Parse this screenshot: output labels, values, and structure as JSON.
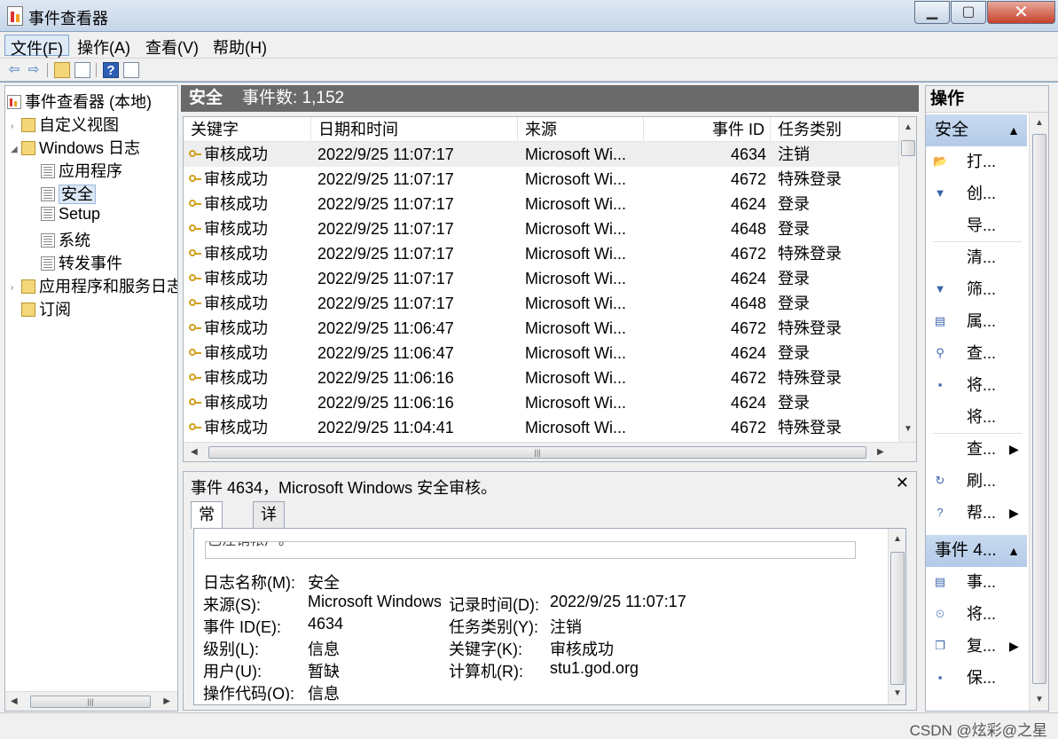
{
  "window": {
    "title": "事件查看器",
    "min_glyph": "▁",
    "max_glyph": "▢",
    "close_glyph": "✕"
  },
  "menu": [
    {
      "label": "文件(F)",
      "active": true
    },
    {
      "label": "操作(A)",
      "active": false
    },
    {
      "label": "查看(V)",
      "active": false
    },
    {
      "label": "帮助(H)",
      "active": false
    }
  ],
  "toolbar": {
    "back_glyph": "⇦",
    "forward_glyph": "⇨",
    "help_glyph": "?"
  },
  "tree": {
    "items": [
      {
        "label": "事件查看器 (本地)",
        "icon": "event-viewer-icon",
        "arrow": "",
        "level": 0,
        "selected": false
      },
      {
        "label": "自定义视图",
        "icon": "folder-icon",
        "arrow": "›",
        "level": 1,
        "selected": false
      },
      {
        "label": "Windows 日志",
        "icon": "folder-icon",
        "arrow": "◢",
        "level": 1,
        "selected": false
      },
      {
        "label": "应用程序",
        "icon": "log-icon",
        "arrow": "",
        "level": 2,
        "selected": false
      },
      {
        "label": "安全",
        "icon": "log-icon",
        "arrow": "",
        "level": 2,
        "selected": true
      },
      {
        "label": "Setup",
        "icon": "log-icon",
        "arrow": "",
        "level": 2,
        "selected": false
      },
      {
        "label": "系统",
        "icon": "log-icon",
        "arrow": "",
        "level": 2,
        "selected": false
      },
      {
        "label": "转发事件",
        "icon": "log-icon",
        "arrow": "",
        "level": 2,
        "selected": false
      },
      {
        "label": "应用程序和服务日志",
        "icon": "folder-icon",
        "arrow": "›",
        "level": 1,
        "selected": false
      },
      {
        "label": "订阅",
        "icon": "subscription-icon",
        "arrow": "",
        "level": 1,
        "selected": false
      }
    ]
  },
  "log": {
    "title": "安全",
    "count_text": "事件数: 1,152"
  },
  "grid": {
    "columns": [
      "关键字",
      "日期和时间",
      "来源",
      "事件 ID",
      "任务类别"
    ],
    "rows": [
      {
        "keyword": "审核成功",
        "datetime": "2022/9/25 11:07:17",
        "source": "Microsoft Wi...",
        "event_id": "4634",
        "category": "注销"
      },
      {
        "keyword": "审核成功",
        "datetime": "2022/9/25 11:07:17",
        "source": "Microsoft Wi...",
        "event_id": "4672",
        "category": "特殊登录"
      },
      {
        "keyword": "审核成功",
        "datetime": "2022/9/25 11:07:17",
        "source": "Microsoft Wi...",
        "event_id": "4624",
        "category": "登录"
      },
      {
        "keyword": "审核成功",
        "datetime": "2022/9/25 11:07:17",
        "source": "Microsoft Wi...",
        "event_id": "4648",
        "category": "登录"
      },
      {
        "keyword": "审核成功",
        "datetime": "2022/9/25 11:07:17",
        "source": "Microsoft Wi...",
        "event_id": "4672",
        "category": "特殊登录"
      },
      {
        "keyword": "审核成功",
        "datetime": "2022/9/25 11:07:17",
        "source": "Microsoft Wi...",
        "event_id": "4624",
        "category": "登录"
      },
      {
        "keyword": "审核成功",
        "datetime": "2022/9/25 11:07:17",
        "source": "Microsoft Wi...",
        "event_id": "4648",
        "category": "登录"
      },
      {
        "keyword": "审核成功",
        "datetime": "2022/9/25 11:06:47",
        "source": "Microsoft Wi...",
        "event_id": "4672",
        "category": "特殊登录"
      },
      {
        "keyword": "审核成功",
        "datetime": "2022/9/25 11:06:47",
        "source": "Microsoft Wi...",
        "event_id": "4624",
        "category": "登录"
      },
      {
        "keyword": "审核成功",
        "datetime": "2022/9/25 11:06:16",
        "source": "Microsoft Wi...",
        "event_id": "4672",
        "category": "特殊登录"
      },
      {
        "keyword": "审核成功",
        "datetime": "2022/9/25 11:06:16",
        "source": "Microsoft Wi...",
        "event_id": "4624",
        "category": "登录"
      },
      {
        "keyword": "审核成功",
        "datetime": "2022/9/25 11:04:41",
        "source": "Microsoft Wi...",
        "event_id": "4672",
        "category": "特殊登录"
      }
    ]
  },
  "detail": {
    "title": "事件 4634，Microsoft Windows 安全审核。",
    "close_glyph": "✕",
    "tabs": [
      {
        "label": "常规",
        "active": true
      },
      {
        "label": "详细信息",
        "active": false
      }
    ],
    "description": "已注销帐户。",
    "fields": {
      "log_name_label": "日志名称(M):",
      "log_name_value": "安全",
      "source_label": "来源(S):",
      "source_value": "Microsoft Windows",
      "logged_label": "记录时间(D):",
      "logged_value": "2022/9/25 11:07:17",
      "event_id_label": "事件 ID(E):",
      "event_id_value": "4634",
      "task_label": "任务类别(Y):",
      "task_value": "注销",
      "level_label": "级别(L):",
      "level_value": "信息",
      "keywords_label": "关键字(K):",
      "keywords_value": "审核成功",
      "user_label": "用户(U):",
      "user_value": "暂缺",
      "computer_label": "计算机(R):",
      "computer_value": "stu1.god.org",
      "opcode_label": "操作代码(O):",
      "opcode_value": "信息"
    }
  },
  "actions": {
    "title": "操作",
    "sections": [
      {
        "label": "安全",
        "caret": "▲",
        "items": [
          {
            "label": "打...",
            "icon": "open-icon",
            "glyph": "📂",
            "submenu": false
          },
          {
            "label": "创...",
            "icon": "filter-icon",
            "glyph": "▼",
            "submenu": false
          },
          {
            "label": "导...",
            "icon": "",
            "glyph": "",
            "submenu": false
          },
          {
            "label": "清...",
            "icon": "",
            "glyph": "",
            "submenu": false
          },
          {
            "label": "筛...",
            "icon": "filter-icon",
            "glyph": "▼",
            "submenu": false
          },
          {
            "label": "属...",
            "icon": "properties-icon",
            "glyph": "▤",
            "submenu": false
          },
          {
            "label": "查...",
            "icon": "find-icon",
            "glyph": "⚲",
            "submenu": false
          },
          {
            "label": "将...",
            "icon": "save-icon",
            "glyph": "▪",
            "submenu": false
          },
          {
            "label": "将...",
            "icon": "",
            "glyph": "",
            "submenu": false
          },
          {
            "label": "查...",
            "icon": "",
            "glyph": "",
            "submenu": true
          },
          {
            "label": "刷...",
            "icon": "refresh-icon",
            "glyph": "↻",
            "submenu": false
          },
          {
            "label": "帮...",
            "icon": "help-icon",
            "glyph": "?",
            "submenu": true
          }
        ]
      },
      {
        "label": "事件 4...",
        "caret": "▲",
        "items": [
          {
            "label": "事...",
            "icon": "event-properties-icon",
            "glyph": "▤",
            "submenu": false
          },
          {
            "label": "将...",
            "icon": "attach-task-icon",
            "glyph": "⏲",
            "submenu": false
          },
          {
            "label": "复...",
            "icon": "copy-icon",
            "glyph": "❐",
            "submenu": true
          },
          {
            "label": "保...",
            "icon": "save-icon",
            "glyph": "▪",
            "submenu": false
          }
        ]
      }
    ],
    "submenu_glyph": "▶"
  },
  "watermark": "CSDN @炫彩@之星"
}
